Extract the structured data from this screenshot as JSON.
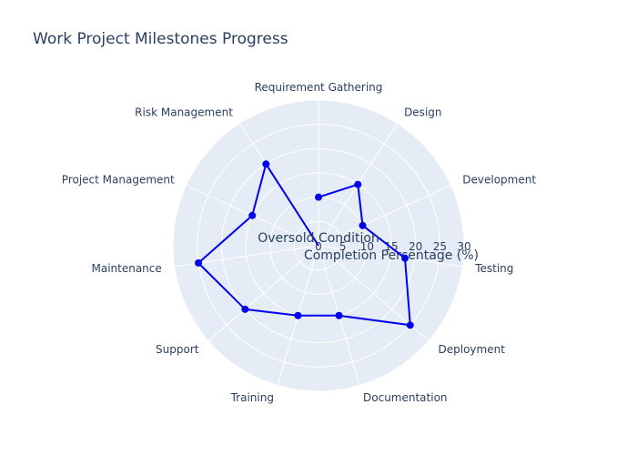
{
  "title": "Work Project Milestones Progress",
  "chart_data": {
    "type": "polar-line",
    "title": "Work Project Milestones Progress",
    "series": [
      {
        "name": "",
        "color": "#0000ee",
        "categories": [
          "Requirement Gathering",
          "Design",
          "Development",
          "Testing",
          "Deployment",
          "Documentation",
          "Training",
          "Support",
          "Maintenance",
          "Project Management",
          "Risk Management",
          "Oversold Condition"
        ],
        "values": [
          10,
          15,
          10,
          18,
          25,
          15,
          15,
          20,
          25,
          15,
          20,
          0
        ]
      }
    ],
    "radial_axis": {
      "title": "Completion Percentage (%)",
      "range": [
        0,
        30
      ],
      "ticks": [
        "0",
        "5",
        "10",
        "15",
        "20",
        "25",
        "30"
      ]
    },
    "angular_axis": {
      "categories": [
        "Requirement Gathering",
        "Design",
        "Development",
        "Testing",
        "Deployment",
        "Documentation",
        "Training",
        "Support",
        "Maintenance",
        "Project Management",
        "Risk Management"
      ],
      "direction": "clockwise",
      "rotation_start": "top"
    },
    "colors": {
      "background": "#e5ecf6",
      "grid": "#ffffff",
      "line": "#0000ee",
      "text": "#2a3f5f"
    },
    "grid": true
  }
}
